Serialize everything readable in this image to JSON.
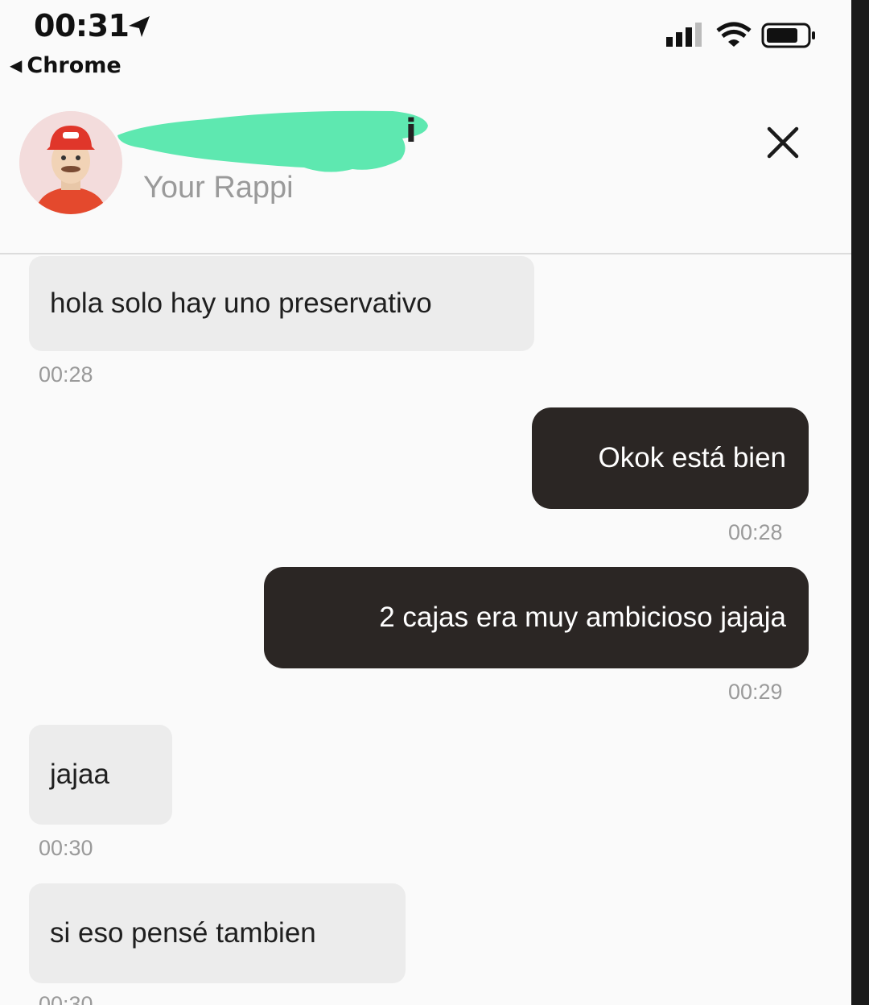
{
  "status_bar": {
    "time": "00:31",
    "back_app": "Chrome"
  },
  "header": {
    "subtitle": "Your Rappi",
    "name_visible_tail": "i"
  },
  "messages": [
    {
      "direction": "in",
      "text": "hola solo hay uno preservativo",
      "time": "00:28"
    },
    {
      "direction": "out",
      "text": "Okok está bien",
      "time": "00:28"
    },
    {
      "direction": "out",
      "text": "2 cajas era muy ambicioso jajaja",
      "time": "00:29"
    },
    {
      "direction": "in",
      "text": "jajaa",
      "time": "00:30"
    },
    {
      "direction": "in",
      "text": "si eso pensé  tambien",
      "time": "00:30"
    }
  ],
  "colors": {
    "incoming_bubble": "#ececec",
    "outgoing_bubble": "#2b2624",
    "redaction": "#5ee8b0",
    "timestamp": "#9a9a9a"
  },
  "icons": [
    "location-arrow-icon",
    "back-triangle-icon",
    "signal-icon",
    "wifi-icon",
    "battery-icon",
    "close-icon"
  ]
}
